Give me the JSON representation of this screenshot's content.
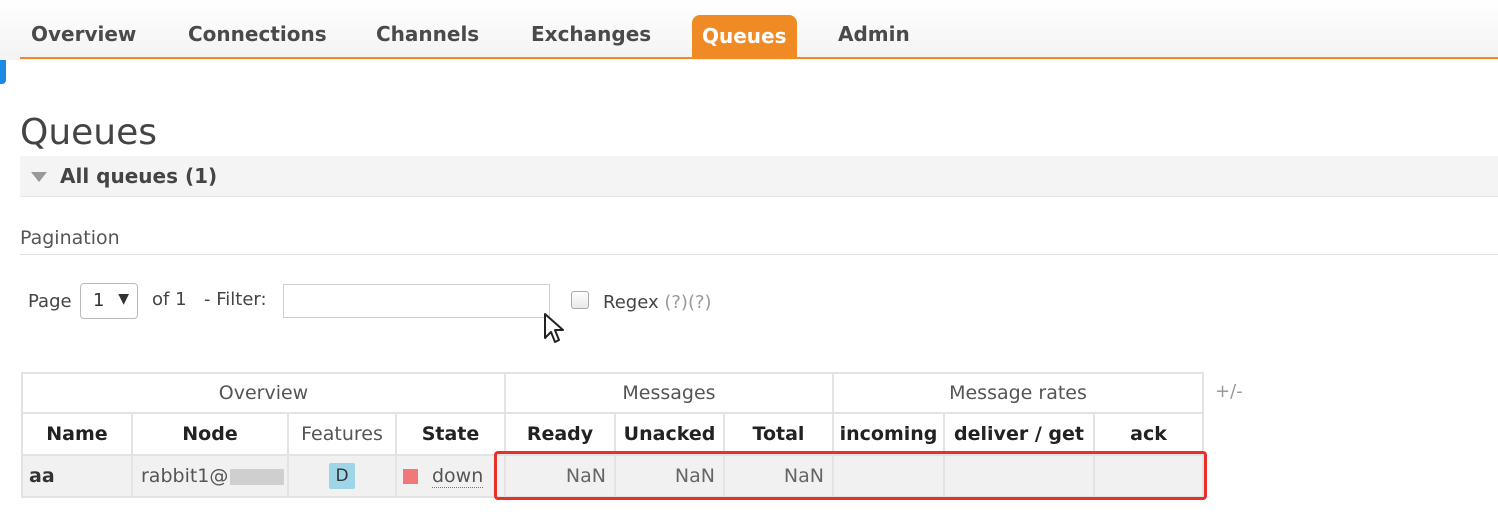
{
  "nav": {
    "items": [
      "Overview",
      "Connections",
      "Channels",
      "Exchanges",
      "Queues",
      "Admin"
    ],
    "active": "Queues"
  },
  "page": {
    "title": "Queues"
  },
  "section": {
    "title": "All queues (1)"
  },
  "pagination": {
    "heading": "Pagination",
    "page_label": "Page",
    "page_value": "1",
    "of_label": "of 1",
    "filter_label": "- Filter:",
    "filter_value": "",
    "regex_label": "Regex",
    "regex_checked": false,
    "help1": "(?)",
    "help2": "(?)"
  },
  "table": {
    "groups": [
      "Overview",
      "Messages",
      "Message rates"
    ],
    "columns": [
      "Name",
      "Node",
      "Features",
      "State",
      "Ready",
      "Unacked",
      "Total",
      "incoming",
      "deliver / get",
      "ack"
    ],
    "rows": [
      {
        "name": "aa",
        "node": "rabbit1@",
        "feature": "D",
        "state": "down",
        "ready": "NaN",
        "unacked": "NaN",
        "total": "NaN",
        "incoming": "",
        "deliver_get": "",
        "ack": ""
      }
    ],
    "toggle_columns": "+/-"
  },
  "colors": {
    "accent": "#f08a24",
    "state_down": "#f07878",
    "feature_badge": "#9ed6e8",
    "highlight": "#e8302a"
  }
}
